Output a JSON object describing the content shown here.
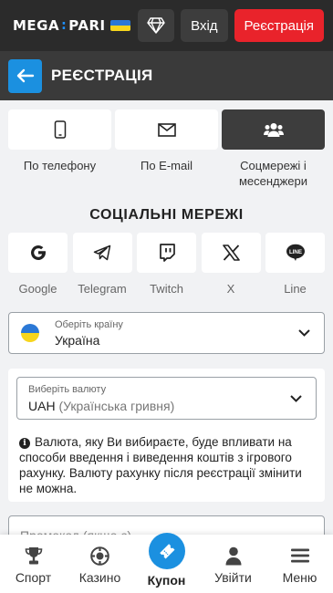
{
  "header": {
    "logo_left": "MEGA",
    "logo_right": "PARI",
    "login_label": "Вхід",
    "register_label": "Реєстрація"
  },
  "titlebar": {
    "title": "РЕЄСТРАЦІЯ"
  },
  "methods": [
    {
      "label": "По телефону",
      "icon": "phone-icon",
      "active": false
    },
    {
      "label": "По E-mail",
      "icon": "envelope-icon",
      "active": false
    },
    {
      "label": "Соцмережі і месенджери",
      "icon": "users-icon",
      "active": true
    }
  ],
  "social_section": {
    "title": "СОЦІАЛЬНІ МЕРЕЖІ",
    "items": [
      {
        "label": "Google",
        "icon": "google-icon"
      },
      {
        "label": "Telegram",
        "icon": "telegram-icon"
      },
      {
        "label": "Twitch",
        "icon": "twitch-icon"
      },
      {
        "label": "X",
        "icon": "x-icon"
      },
      {
        "label": "Line",
        "icon": "line-icon"
      }
    ]
  },
  "country": {
    "label": "Оберіть країну",
    "value": "Україна"
  },
  "currency": {
    "label": "Виберіть валюту",
    "code": "UAH",
    "name": "(Українська гривня)",
    "info": "Валюта, яку Ви вибираєте, буде впливати на способи введення і виведення коштів з ігрового рахунку. Валюту рахунку після реєстрації змінити не можна."
  },
  "promo": {
    "placeholder": "Промокод (якщо є)"
  },
  "bottom_nav": {
    "sport": "Спорт",
    "casino": "Казино",
    "coupon": "Купон",
    "login": "Увійти",
    "menu": "Меню"
  },
  "colors": {
    "brand_blue": "#1b90e0",
    "register_red": "#e9232b",
    "header_dark": "#2b2b2b"
  }
}
